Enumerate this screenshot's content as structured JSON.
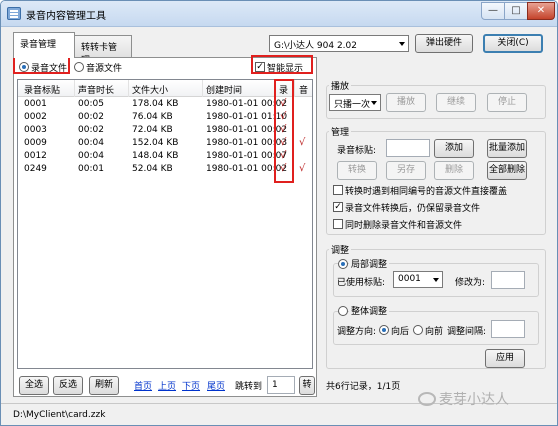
{
  "window": {
    "title": "录音内容管理工具",
    "min_glyph": "—",
    "max_glyph": "□",
    "close_glyph": "✕"
  },
  "tabs": [
    {
      "label": "录音管理",
      "active": true
    },
    {
      "label": "转转卡管理",
      "active": false
    }
  ],
  "toolbar": {
    "device_value": "G:\\小达人 904 2.02",
    "eject_label": "弹出硬件",
    "close_label": "关闭(C)"
  },
  "filter": {
    "record_files_label": "录音文件",
    "audio_files_label": "音源文件",
    "smart_display_label": "智能显示",
    "smart_display_checked": "✓"
  },
  "table": {
    "headers": [
      "录音标贴",
      "声音时长",
      "文件大小",
      "创建时间",
      "录",
      "音"
    ],
    "rows": [
      {
        "tag": "0001",
        "duration": "00:05",
        "size": "178.04 KB",
        "created": "1980-01-01 00:02",
        "rec": "√",
        "audio": ""
      },
      {
        "tag": "0002",
        "duration": "00:02",
        "size": "76.04 KB",
        "created": "1980-01-01 01:10",
        "rec": "√",
        "audio": ""
      },
      {
        "tag": "0003",
        "duration": "00:02",
        "size": "72.04 KB",
        "created": "1980-01-01 00:02",
        "rec": "√",
        "audio": ""
      },
      {
        "tag": "0009",
        "duration": "00:04",
        "size": "152.04 KB",
        "created": "1980-01-01 00:03",
        "rec": "√",
        "audio": "√"
      },
      {
        "tag": "0012",
        "duration": "00:04",
        "size": "148.04 KB",
        "created": "1980-01-01 00:07",
        "rec": "√",
        "audio": ""
      },
      {
        "tag": "0249",
        "duration": "00:01",
        "size": "52.04 KB",
        "created": "1980-01-01 00:02",
        "rec": "√",
        "audio": "√"
      }
    ]
  },
  "bottom_bar": {
    "select_all": "全选",
    "invert": "反选",
    "refresh": "刷新",
    "first_page": "首页",
    "prev_page": "上页",
    "next_page": "下页",
    "last_page": "尾页",
    "goto_label": "跳转到",
    "goto_value": "1",
    "goto_button": "转",
    "record_count": "共6行记录，1/1页"
  },
  "playback": {
    "title": "播放",
    "mode_value": "只播一次",
    "play": "播放",
    "continue": "继续",
    "stop": "停止"
  },
  "manage": {
    "title": "管理",
    "tag_label": "录音标贴:",
    "tag_value": "",
    "add": "添加",
    "batch_add": "批量添加",
    "convert": "转换",
    "save_as": "另存",
    "delete": "删除",
    "delete_all": "全部删除",
    "opt1": "转换时遇到相同编号的音源文件直接覆盖",
    "opt1_checked": "",
    "opt2": "录音文件转换后，仍保留录音文件",
    "opt2_checked": "✓",
    "opt3": "同时删除录音文件和音源文件",
    "opt3_checked": ""
  },
  "adjust": {
    "title": "调整",
    "local_label": "局部调整",
    "used_tag_label": "已使用标贴:",
    "used_tag_value": "0001",
    "modify_label": "修改为:",
    "modify_value": "",
    "global_label": "整体调整",
    "direction_label": "调整方向:",
    "backward_label": "向后",
    "forward_label": "向前",
    "interval_label": "调整间隔:",
    "interval_value": "",
    "apply": "应用"
  },
  "status": {
    "path": "D:\\MyClient\\card.zzk"
  },
  "watermark": "麦芽小达人"
}
